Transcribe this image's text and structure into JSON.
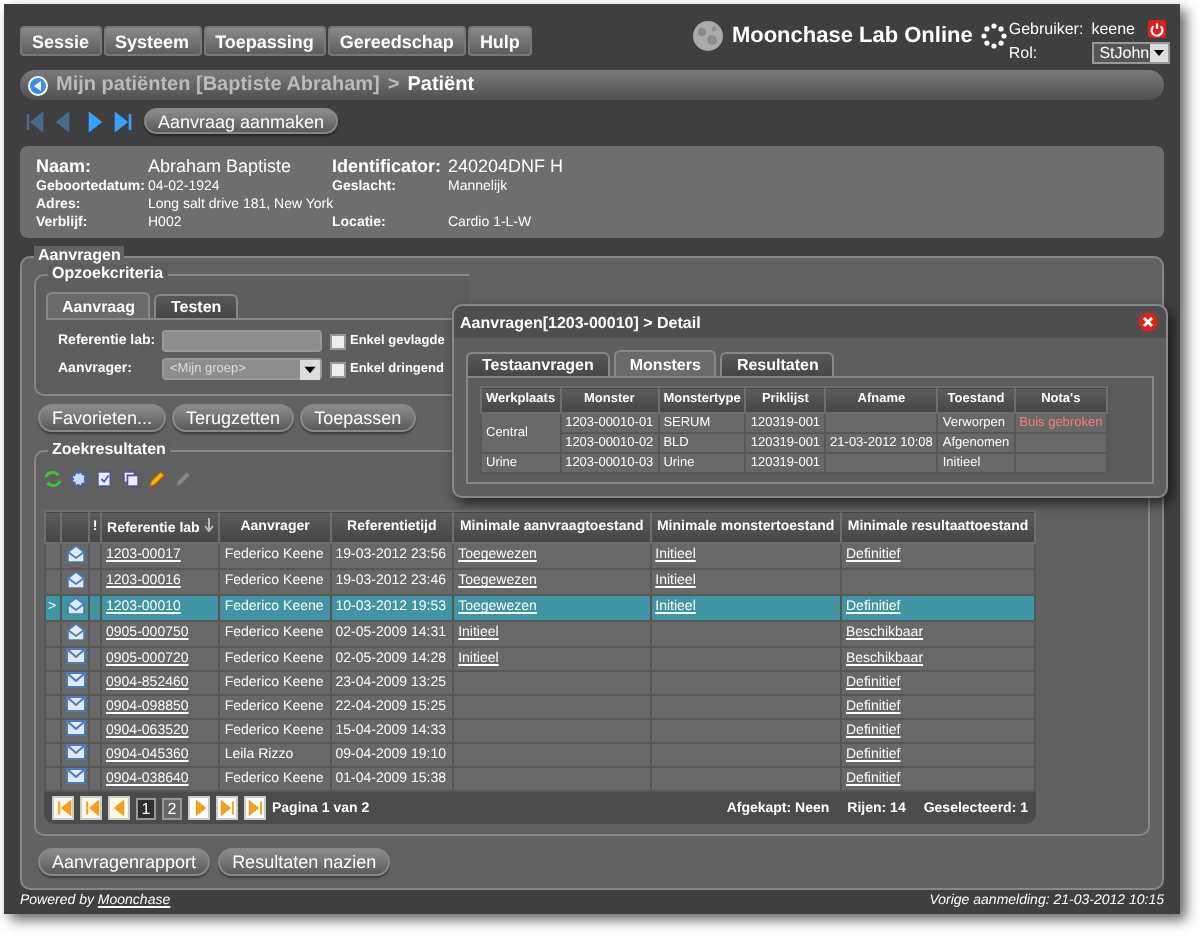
{
  "menu": [
    "Sessie",
    "Systeem",
    "Toepassing",
    "Gereedschap",
    "Hulp"
  ],
  "app_title": "Moonchase Lab Online",
  "user": {
    "label": "Gebruiker:",
    "value": "keene"
  },
  "role": {
    "label": "Rol:",
    "value": "StJohn"
  },
  "breadcrumb": {
    "parent": "Mijn patiënten [Baptiste Abraham]",
    "separator": ">",
    "current": "Patiënt"
  },
  "nav_buttons": [
    {
      "kind": "first",
      "disabled": true
    },
    {
      "kind": "prev",
      "disabled": true
    },
    {
      "kind": "next",
      "disabled": false
    },
    {
      "kind": "last",
      "disabled": false
    }
  ],
  "create_button": "Aanvraag aanmaken",
  "patient": {
    "name": {
      "label": "Naam:",
      "value": "Abraham Baptiste"
    },
    "identifier": {
      "label": "Identificator:",
      "value": "240204DNF H"
    },
    "details": [
      [
        {
          "label": "Geboortedatum:",
          "value": "04-02-1924"
        },
        {
          "label": "Geslacht:",
          "value": "Mannelijk"
        }
      ],
      [
        {
          "label": "Adres:",
          "value": "Long salt drive 181, New York"
        }
      ],
      [
        {
          "label": "Verblijf:",
          "value": "H002"
        },
        {
          "label": "Locatie:",
          "value": "Cardio 1-L-W"
        }
      ]
    ]
  },
  "requests": {
    "legend": "Aanvragen",
    "criteria": {
      "legend": "Opzoekcriteria",
      "tabs": [
        {
          "label": "Aanvraag",
          "selected": true
        },
        {
          "label": "Testen",
          "selected": false
        }
      ],
      "reference_label": "Referentie lab:",
      "requester_label": "Aanvrager:",
      "requester_value": "<Mijn groep>",
      "checkboxes": [
        {
          "label": "Enkel gevlagde",
          "checked": false
        },
        {
          "label": "Enkel dringend",
          "checked": false
        }
      ],
      "buttons": [
        "Favorieten...",
        "Terugzetten",
        "Toepassen"
      ]
    },
    "results": {
      "legend": "Zoekresultaten",
      "current_marker": ">",
      "flag_header": "!",
      "columns": [
        {
          "label": "Referentie lab",
          "sorted": true
        },
        {
          "label": "Aanvrager",
          "sorted": false
        },
        {
          "label": "Referentietijd",
          "sorted": false
        },
        {
          "label": "Minimale aanvraagtoestand",
          "sorted": false
        },
        {
          "label": "Minimale monstertoestand",
          "sorted": false
        },
        {
          "label": "Minimale resultaattoestand",
          "sorted": false
        }
      ],
      "rows": [
        {
          "selected": false,
          "kind": "opened",
          "reference": "1203-00017",
          "requester": "Federico Keene",
          "time": "19-03-2012 23:56",
          "request_state": "Toegewezen",
          "sample_state": "Initieel",
          "result_state": "Definitief"
        },
        {
          "selected": false,
          "kind": "opened",
          "reference": "1203-00016",
          "requester": "Federico Keene",
          "time": "19-03-2012 23:46",
          "request_state": "Toegewezen",
          "sample_state": "Initieel"
        },
        {
          "selected": true,
          "kind": "opened",
          "reference": "1203-00010",
          "requester": "Federico Keene",
          "time": "10-03-2012 19:53",
          "request_state": "Toegewezen",
          "sample_state": "Initieel",
          "result_state": "Definitief"
        },
        {
          "selected": false,
          "kind": "opened",
          "reference": "0905-000750",
          "requester": "Federico Keene",
          "time": "02-05-2009 14:31",
          "request_state": "Initieel",
          "result_state": "Beschikbaar"
        },
        {
          "selected": false,
          "kind": "closed",
          "reference": "0905-000720",
          "requester": "Federico Keene",
          "time": "02-05-2009 14:28",
          "request_state": "Initieel",
          "result_state": "Beschikbaar"
        },
        {
          "selected": false,
          "kind": "closed",
          "reference": "0904-852460",
          "requester": "Federico Keene",
          "time": "23-04-2009 13:25",
          "result_state": "Definitief"
        },
        {
          "selected": false,
          "kind": "closed",
          "reference": "0904-098850",
          "requester": "Federico Keene",
          "time": "22-04-2009 15:25",
          "result_state": "Definitief"
        },
        {
          "selected": false,
          "kind": "closed",
          "reference": "0904-063520",
          "requester": "Federico Keene",
          "time": "15-04-2009 14:33",
          "result_state": "Definitief"
        },
        {
          "selected": false,
          "kind": "closed",
          "reference": "0904-045360",
          "requester": "Leila Rizzo",
          "time": "09-04-2009 19:10",
          "result_state": "Definitief"
        },
        {
          "selected": false,
          "kind": "closed",
          "reference": "0904-038640",
          "requester": "Federico Keene",
          "time": "01-04-2009 15:38",
          "result_state": "Definitief"
        }
      ],
      "pages": [
        {
          "label": "1",
          "selected": true
        },
        {
          "label": "2",
          "selected": false
        }
      ],
      "page_info": "Pagina 1 van 2",
      "stats": [
        "Afgekapt: Neen",
        "Rijen: 14",
        "Geselecteerd: 1"
      ],
      "buttons": [
        "Aanvragenrapport",
        "Resultaten nazien"
      ]
    }
  },
  "detail_dialog": {
    "title": "Aanvragen[1203-00010] > Detail",
    "tabs": [
      {
        "label": "Testaanvragen",
        "selected": false
      },
      {
        "label": "Monsters",
        "selected": true
      },
      {
        "label": "Resultaten",
        "selected": false
      }
    ],
    "columns": [
      "Werkplaats",
      "Monster",
      "Monstertype",
      "Priklijst",
      "Afname",
      "Toestand",
      "Nota's"
    ],
    "groups": [
      {
        "workplace": "Central",
        "samples": [
          {
            "sample": "1203-00010-01",
            "type": "SERUM",
            "list": "120319-001",
            "state": "Verworpen",
            "note": "Buis gebroken"
          },
          {
            "sample": "1203-00010-02",
            "type": "BLD",
            "list": "120319-001",
            "taken": "21-03-2012 10:08",
            "state": "Afgenomen"
          }
        ]
      },
      {
        "workplace": "Urine",
        "samples": [
          {
            "sample": "1203-00010-03",
            "type": "Urine",
            "list": "120319-001",
            "state": "Initieel"
          }
        ]
      }
    ]
  },
  "footer": {
    "powered": "Powered by",
    "link": "Moonchase",
    "last_login": "Vorige aanmelding: 21-03-2012 10:15"
  }
}
